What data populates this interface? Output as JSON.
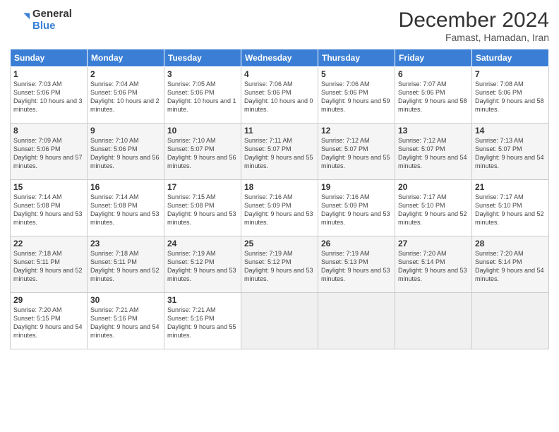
{
  "logo": {
    "general": "General",
    "blue": "Blue"
  },
  "title": "December 2024",
  "location": "Famast, Hamadan, Iran",
  "days_of_week": [
    "Sunday",
    "Monday",
    "Tuesday",
    "Wednesday",
    "Thursday",
    "Friday",
    "Saturday"
  ],
  "weeks": [
    [
      {
        "day": 1,
        "sunrise": "7:03 AM",
        "sunset": "5:06 PM",
        "daylight": "10 hours and 3 minutes."
      },
      {
        "day": 2,
        "sunrise": "7:04 AM",
        "sunset": "5:06 PM",
        "daylight": "10 hours and 2 minutes."
      },
      {
        "day": 3,
        "sunrise": "7:05 AM",
        "sunset": "5:06 PM",
        "daylight": "10 hours and 1 minute."
      },
      {
        "day": 4,
        "sunrise": "7:06 AM",
        "sunset": "5:06 PM",
        "daylight": "10 hours and 0 minutes."
      },
      {
        "day": 5,
        "sunrise": "7:06 AM",
        "sunset": "5:06 PM",
        "daylight": "9 hours and 59 minutes."
      },
      {
        "day": 6,
        "sunrise": "7:07 AM",
        "sunset": "5:06 PM",
        "daylight": "9 hours and 58 minutes."
      },
      {
        "day": 7,
        "sunrise": "7:08 AM",
        "sunset": "5:06 PM",
        "daylight": "9 hours and 58 minutes."
      }
    ],
    [
      {
        "day": 8,
        "sunrise": "7:09 AM",
        "sunset": "5:06 PM",
        "daylight": "9 hours and 57 minutes."
      },
      {
        "day": 9,
        "sunrise": "7:10 AM",
        "sunset": "5:06 PM",
        "daylight": "9 hours and 56 minutes."
      },
      {
        "day": 10,
        "sunrise": "7:10 AM",
        "sunset": "5:07 PM",
        "daylight": "9 hours and 56 minutes."
      },
      {
        "day": 11,
        "sunrise": "7:11 AM",
        "sunset": "5:07 PM",
        "daylight": "9 hours and 55 minutes."
      },
      {
        "day": 12,
        "sunrise": "7:12 AM",
        "sunset": "5:07 PM",
        "daylight": "9 hours and 55 minutes."
      },
      {
        "day": 13,
        "sunrise": "7:12 AM",
        "sunset": "5:07 PM",
        "daylight": "9 hours and 54 minutes."
      },
      {
        "day": 14,
        "sunrise": "7:13 AM",
        "sunset": "5:07 PM",
        "daylight": "9 hours and 54 minutes."
      }
    ],
    [
      {
        "day": 15,
        "sunrise": "7:14 AM",
        "sunset": "5:08 PM",
        "daylight": "9 hours and 53 minutes."
      },
      {
        "day": 16,
        "sunrise": "7:14 AM",
        "sunset": "5:08 PM",
        "daylight": "9 hours and 53 minutes."
      },
      {
        "day": 17,
        "sunrise": "7:15 AM",
        "sunset": "5:08 PM",
        "daylight": "9 hours and 53 minutes."
      },
      {
        "day": 18,
        "sunrise": "7:16 AM",
        "sunset": "5:09 PM",
        "daylight": "9 hours and 53 minutes."
      },
      {
        "day": 19,
        "sunrise": "7:16 AM",
        "sunset": "5:09 PM",
        "daylight": "9 hours and 53 minutes."
      },
      {
        "day": 20,
        "sunrise": "7:17 AM",
        "sunset": "5:10 PM",
        "daylight": "9 hours and 52 minutes."
      },
      {
        "day": 21,
        "sunrise": "7:17 AM",
        "sunset": "5:10 PM",
        "daylight": "9 hours and 52 minutes."
      }
    ],
    [
      {
        "day": 22,
        "sunrise": "7:18 AM",
        "sunset": "5:11 PM",
        "daylight": "9 hours and 52 minutes."
      },
      {
        "day": 23,
        "sunrise": "7:18 AM",
        "sunset": "5:11 PM",
        "daylight": "9 hours and 52 minutes."
      },
      {
        "day": 24,
        "sunrise": "7:19 AM",
        "sunset": "5:12 PM",
        "daylight": "9 hours and 53 minutes."
      },
      {
        "day": 25,
        "sunrise": "7:19 AM",
        "sunset": "5:12 PM",
        "daylight": "9 hours and 53 minutes."
      },
      {
        "day": 26,
        "sunrise": "7:19 AM",
        "sunset": "5:13 PM",
        "daylight": "9 hours and 53 minutes."
      },
      {
        "day": 27,
        "sunrise": "7:20 AM",
        "sunset": "5:14 PM",
        "daylight": "9 hours and 53 minutes."
      },
      {
        "day": 28,
        "sunrise": "7:20 AM",
        "sunset": "5:14 PM",
        "daylight": "9 hours and 54 minutes."
      }
    ],
    [
      {
        "day": 29,
        "sunrise": "7:20 AM",
        "sunset": "5:15 PM",
        "daylight": "9 hours and 54 minutes."
      },
      {
        "day": 30,
        "sunrise": "7:21 AM",
        "sunset": "5:16 PM",
        "daylight": "9 hours and 54 minutes."
      },
      {
        "day": 31,
        "sunrise": "7:21 AM",
        "sunset": "5:16 PM",
        "daylight": "9 hours and 55 minutes."
      },
      null,
      null,
      null,
      null
    ]
  ]
}
